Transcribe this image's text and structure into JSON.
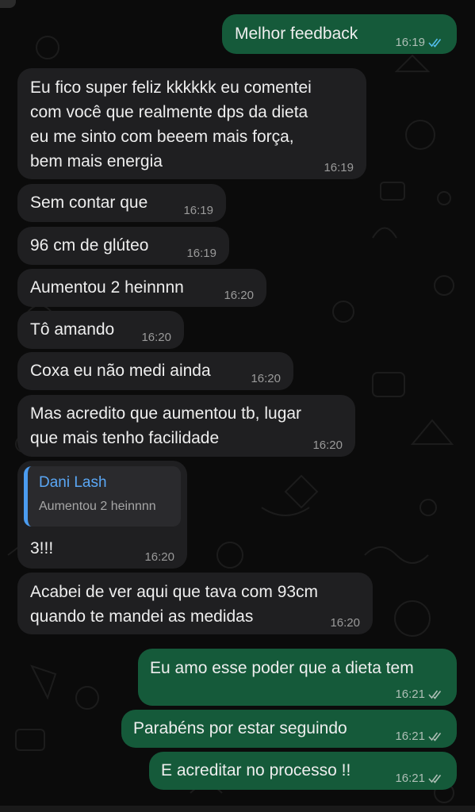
{
  "colors": {
    "background": "#0b0b0b",
    "incoming_bubble": "#1f1f21",
    "outgoing_bubble": "#155a3a",
    "read_ticks": "#53bdeb",
    "quote_accent": "#4b9cf0"
  },
  "messages": [
    {
      "text": "Melhor feedback",
      "time": "16:19",
      "direction": "out",
      "status": "read"
    },
    {
      "text": "Eu fico super feliz kkkkkk eu comentei\ncom você que realmente dps da dieta\neu me sinto com beeem mais força,\nbem mais energia",
      "time": "16:19",
      "direction": "in"
    },
    {
      "text": "Sem contar que",
      "time": "16:19",
      "direction": "in"
    },
    {
      "text": "96 cm de glúteo",
      "time": "16:19",
      "direction": "in"
    },
    {
      "text": "Aumentou 2 heinnnn",
      "time": "16:20",
      "direction": "in"
    },
    {
      "text": "Tô amando",
      "time": "16:20",
      "direction": "in"
    },
    {
      "text": "Coxa eu não medi ainda",
      "time": "16:20",
      "direction": "in"
    },
    {
      "text": "Mas acredito que aumentou tb, lugar\nque mais tenho facilidade",
      "time": "16:20",
      "direction": "in"
    },
    {
      "text": "3!!!",
      "time": "16:20",
      "direction": "in",
      "quoted": {
        "author": "Dani Lash",
        "text": "Aumentou 2 heinnnn"
      }
    },
    {
      "text": "Acabei de ver aqui que tava com 93cm\nquando te mandei as medidas",
      "time": "16:20",
      "direction": "in"
    },
    {
      "text": "Eu amo esse poder que a dieta tem",
      "time": "16:21",
      "direction": "out",
      "status": "delivered"
    },
    {
      "text": "Parabéns por estar seguindo",
      "time": "16:21",
      "direction": "out",
      "status": "delivered"
    },
    {
      "text": "E acreditar no processo !!",
      "time": "16:21",
      "direction": "out",
      "status": "delivered"
    }
  ]
}
